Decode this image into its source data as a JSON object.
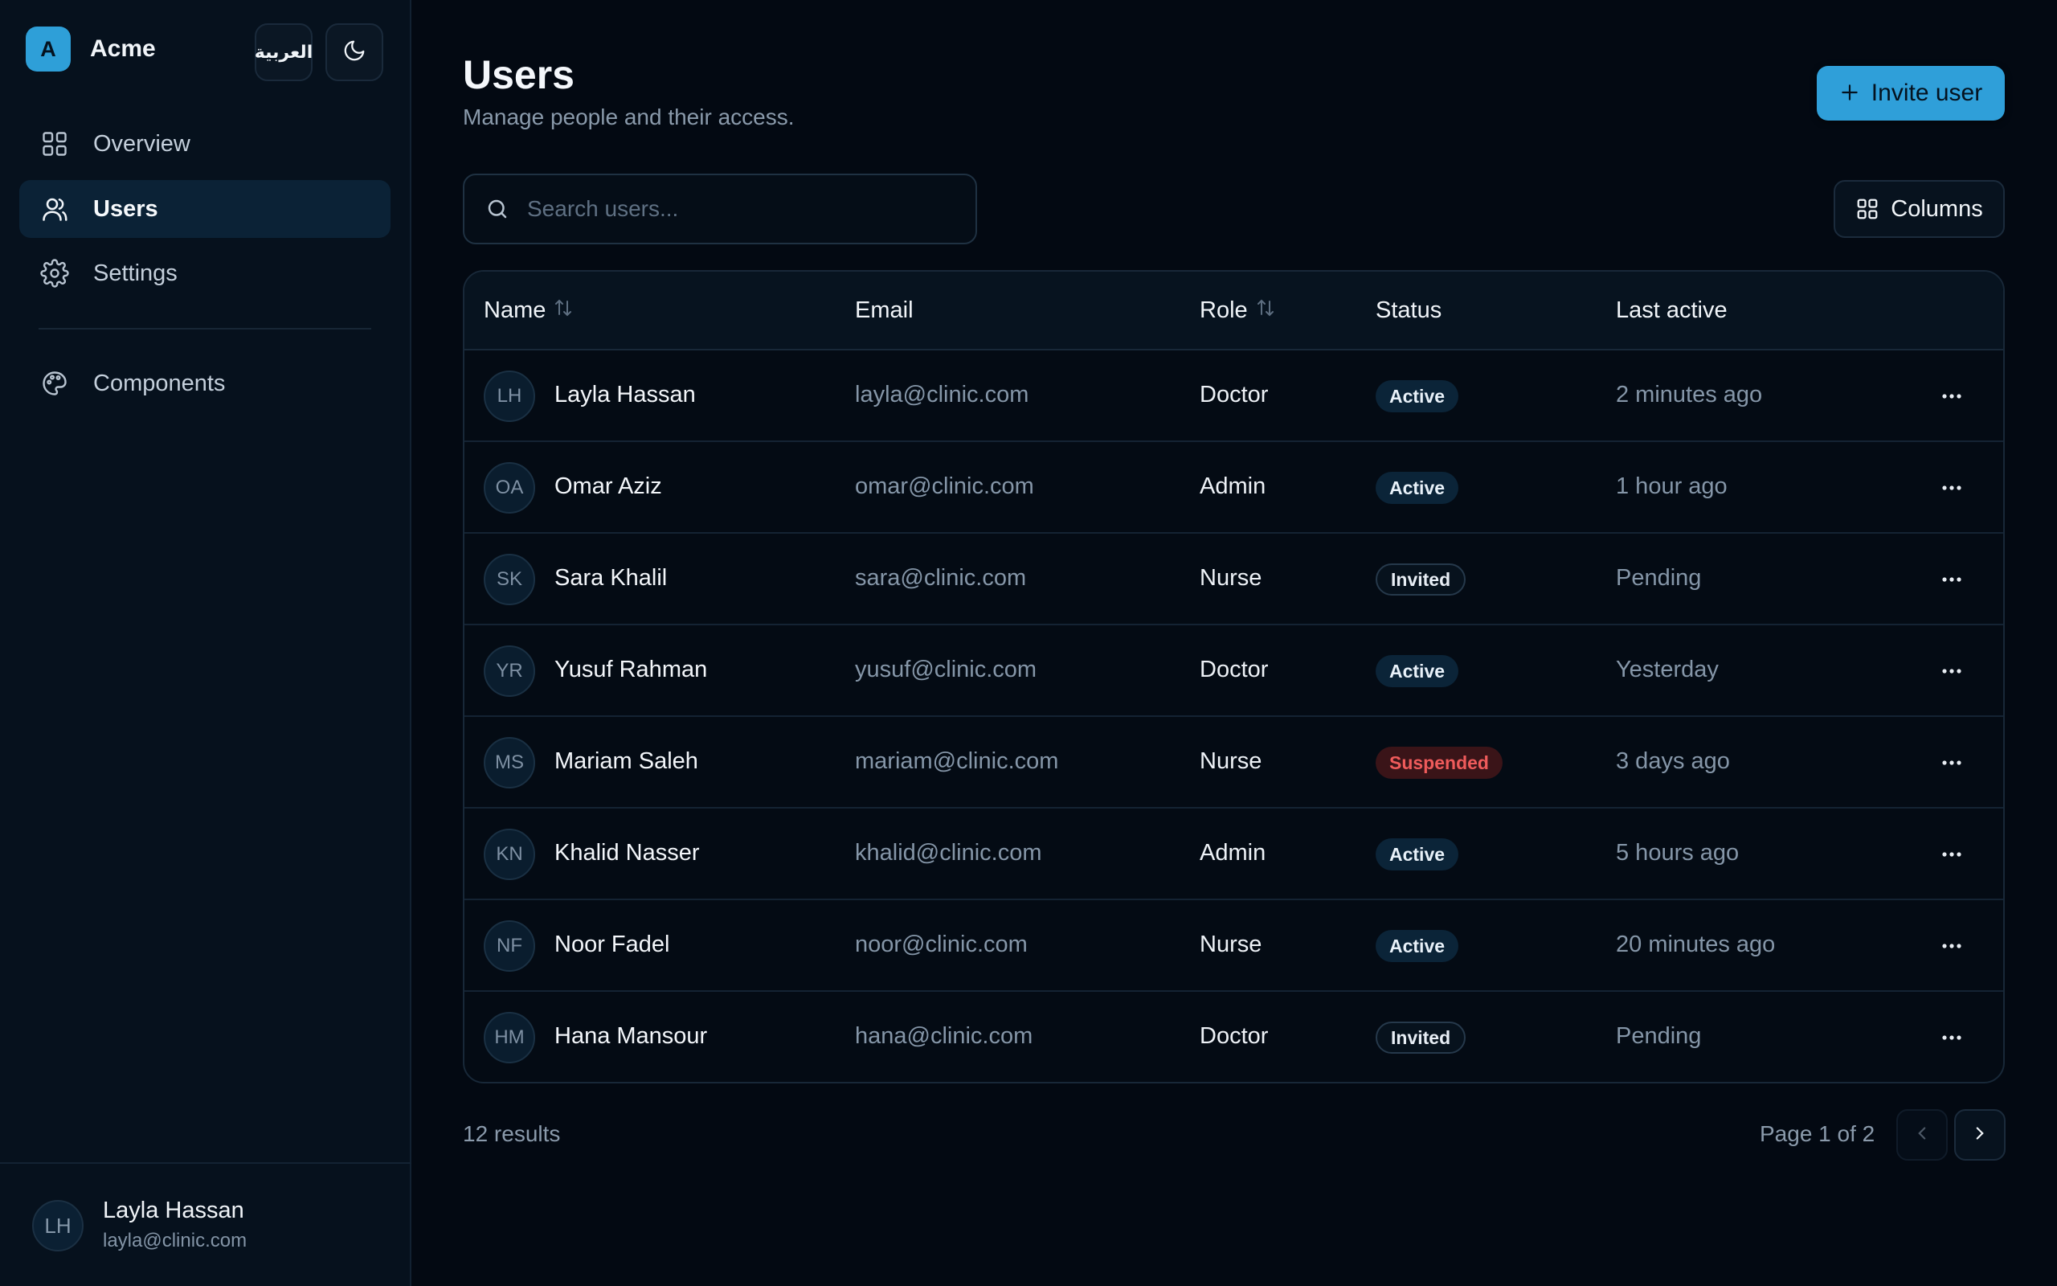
{
  "brand": {
    "logo_letter": "A",
    "name": "Acme"
  },
  "top_buttons": {
    "language_label": "العربية",
    "theme_icon": "moon-icon"
  },
  "nav": {
    "items": [
      {
        "label": "Overview",
        "icon": "grid-icon"
      },
      {
        "label": "Users",
        "icon": "users-icon",
        "active": true
      },
      {
        "label": "Settings",
        "icon": "gear-icon"
      },
      {
        "label": "Components",
        "icon": "palette-icon"
      }
    ]
  },
  "current_user": {
    "initials": "LH",
    "name": "Layla Hassan",
    "email": "layla@clinic.com"
  },
  "header": {
    "title": "Users",
    "subtitle": "Manage people and their access.",
    "invite_label": "Invite user"
  },
  "search": {
    "placeholder": "Search users..."
  },
  "columns_button": {
    "label": "Columns"
  },
  "table": {
    "headers": {
      "name": "Name",
      "email": "Email",
      "role": "Role",
      "status": "Status",
      "last_active": "Last active"
    },
    "rows": [
      {
        "initials": "LH",
        "name": "Layla Hassan",
        "email": "layla@clinic.com",
        "role": "Doctor",
        "status": "Active",
        "last_active": "2 minutes ago"
      },
      {
        "initials": "OA",
        "name": "Omar Aziz",
        "email": "omar@clinic.com",
        "role": "Admin",
        "status": "Active",
        "last_active": "1 hour ago"
      },
      {
        "initials": "SK",
        "name": "Sara Khalil",
        "email": "sara@clinic.com",
        "role": "Nurse",
        "status": "Invited",
        "last_active": "Pending"
      },
      {
        "initials": "YR",
        "name": "Yusuf Rahman",
        "email": "yusuf@clinic.com",
        "role": "Doctor",
        "status": "Active",
        "last_active": "Yesterday"
      },
      {
        "initials": "MS",
        "name": "Mariam Saleh",
        "email": "mariam@clinic.com",
        "role": "Nurse",
        "status": "Suspended",
        "last_active": "3 days ago"
      },
      {
        "initials": "KN",
        "name": "Khalid Nasser",
        "email": "khalid@clinic.com",
        "role": "Admin",
        "status": "Active",
        "last_active": "5 hours ago"
      },
      {
        "initials": "NF",
        "name": "Noor Fadel",
        "email": "noor@clinic.com",
        "role": "Nurse",
        "status": "Active",
        "last_active": "20 minutes ago"
      },
      {
        "initials": "HM",
        "name": "Hana Mansour",
        "email": "hana@clinic.com",
        "role": "Doctor",
        "status": "Invited",
        "last_active": "Pending"
      }
    ]
  },
  "footer": {
    "results": "12 results",
    "page_info": "Page 1 of 2"
  },
  "colors": {
    "accent": "#2f9fd9",
    "background": "#030912",
    "sidebar": "#06111d",
    "danger": "#ef5b5b"
  }
}
